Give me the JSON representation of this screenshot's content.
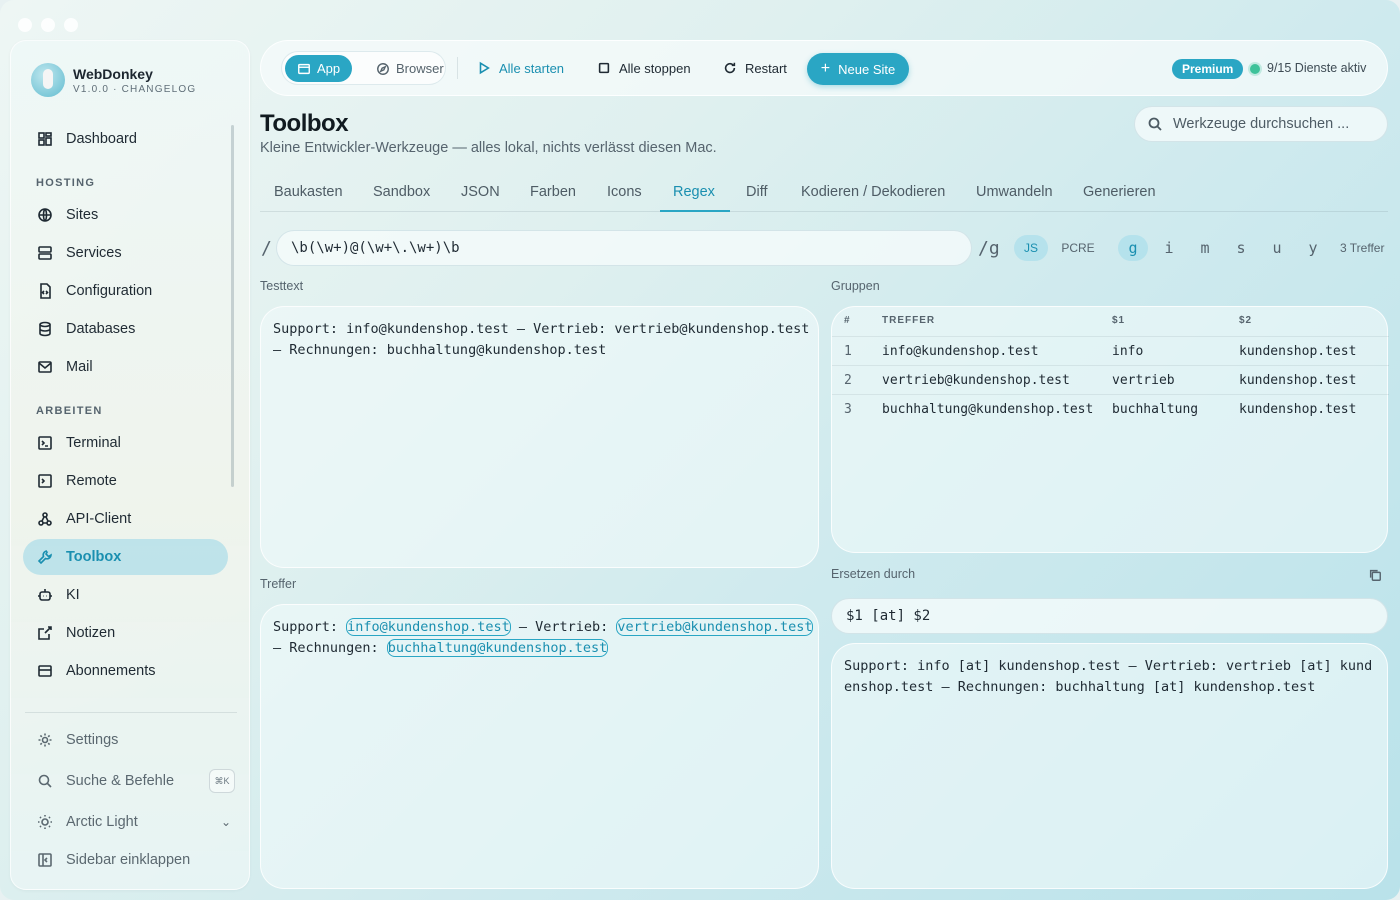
{
  "brand": {
    "name": "WebDonkey",
    "version": "V1.0.0 · CHANGELOG"
  },
  "sidebar": {
    "dashboard": "Dashboard",
    "sections": {
      "hosting": "HOSTING",
      "arbeiten": "ARBEITEN"
    },
    "items": [
      "Sites",
      "Services",
      "Configuration",
      "Databases",
      "Mail",
      "Terminal",
      "Remote",
      "API-Client",
      "Toolbox",
      "KI",
      "Notizen",
      "Abonnements"
    ],
    "footer": {
      "settings": "Settings",
      "search": "Suche & Befehle",
      "shortcut": "⌘K",
      "theme": "Arctic Light",
      "collapse": "Sidebar einklappen"
    }
  },
  "toolbar": {
    "app": "App",
    "browser": "Browser",
    "start_all": "Alle starten",
    "stop_all": "Alle stoppen",
    "restart": "Restart",
    "new_site": "Neue Site",
    "premium": "Premium",
    "status": "9/15 Dienste aktiv"
  },
  "page": {
    "title": "Toolbox",
    "subtitle": "Kleine Entwickler-Werkzeuge — alles lokal, nichts verlässt diesen Mac.",
    "search_placeholder": "Werkzeuge durchsuchen ..."
  },
  "tabs": [
    "Baukasten",
    "Sandbox",
    "JSON",
    "Farben",
    "Icons",
    "Regex",
    "Diff",
    "Kodieren / Dekodieren",
    "Umwandeln",
    "Generieren"
  ],
  "regex": {
    "slash": "/",
    "pattern": "\\b(\\w+)@(\\w+\\.\\w+)\\b",
    "suffix": "/g",
    "engines": [
      "JS",
      "PCRE"
    ],
    "flags": [
      "g",
      "i",
      "m",
      "s",
      "u",
      "y"
    ],
    "match_count": "3 Treffer"
  },
  "labels": {
    "testtext": "Testtext",
    "gruppen": "Gruppen",
    "treffer": "Treffer",
    "ersetzen": "Ersetzen durch"
  },
  "testtext": "Support: info@kundenshop.test — Vertrieb: vertrieb@kundenshop.test — Rechnungen: buchhaltung@kundenshop.test",
  "matches_display": {
    "p1": "Support: ",
    "m1": "info@kundenshop.test",
    "p2": " — Vertrieb: ",
    "m2": "vertrieb@kundenshop.test",
    "p3": " — Rechnungen: ",
    "m3": "buchhaltung@kundenshop.test"
  },
  "groups": {
    "headers": [
      "#",
      "TREFFER",
      "$1",
      "$2"
    ],
    "rows": [
      [
        "1",
        "info@kundenshop.test",
        "info",
        "kundenshop.test"
      ],
      [
        "2",
        "vertrieb@kundenshop.test",
        "vertrieb",
        "kundenshop.test"
      ],
      [
        "3",
        "buchhaltung@kundenshop.test",
        "buchhaltung",
        "kundenshop.test"
      ]
    ]
  },
  "replace": {
    "pattern": "$1 [at] $2",
    "result": "Support: info [at] kundenshop.test — Vertrieb: vertrieb [at] kundenshop.test — Rechnungen: buchhaltung [at] kundenshop.test"
  }
}
